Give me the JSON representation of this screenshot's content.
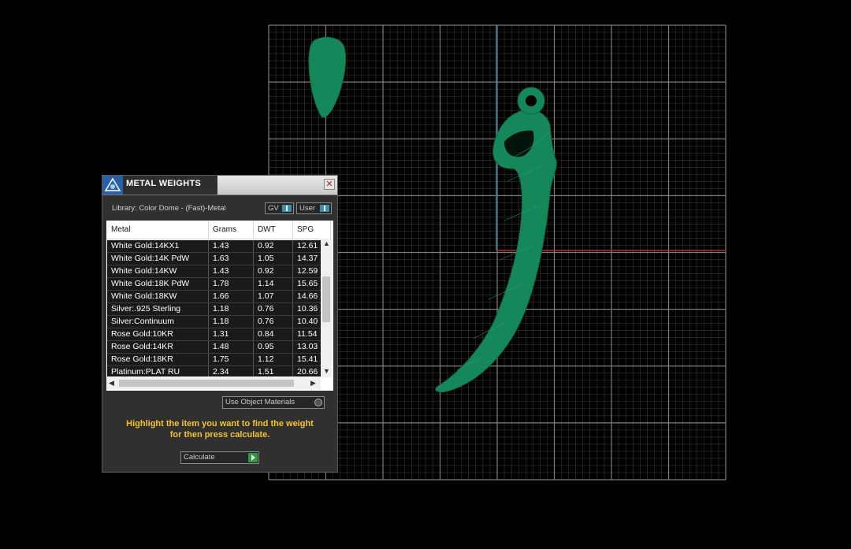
{
  "panel": {
    "title": "METAL WEIGHTS",
    "close_glyph": "✕",
    "library_label": "Library: Color Dome - (Fast)-Metal",
    "gv_toggle": "GV",
    "user_toggle": "User",
    "columns": [
      "Metal",
      "Grams",
      "DWT",
      "SPG"
    ],
    "rows": [
      [
        "White Gold:14KX1",
        "1.43",
        "0.92",
        "12.61"
      ],
      [
        "White Gold:14K PdW",
        "1.63",
        "1.05",
        "14.37"
      ],
      [
        "White Gold:14KW",
        "1.43",
        "0.92",
        "12.59"
      ],
      [
        "White Gold:18K PdW",
        "1.78",
        "1.14",
        "15.65"
      ],
      [
        "White Gold:18KW",
        "1.66",
        "1.07",
        "14.66"
      ],
      [
        "Silver:.925 Sterling",
        "1.18",
        "0.76",
        "10.36"
      ],
      [
        "Silver:Continuum",
        "1.18",
        "0.76",
        "10.40"
      ],
      [
        "Rose Gold:10KR",
        "1.31",
        "0.84",
        "11.54"
      ],
      [
        "Rose Gold:14KR",
        "1.48",
        "0.95",
        "13.03"
      ],
      [
        "Rose Gold:18KR",
        "1.75",
        "1.12",
        "15.41"
      ],
      [
        "Platinum:PLAT RU",
        "2.34",
        "1.51",
        "20.66"
      ]
    ],
    "use_object_materials": "Use Object Materials",
    "hint_line1": "Highlight the item you want to find the weight",
    "hint_line2": "for then press calculate.",
    "calculate_label": "Calculate"
  },
  "colors": {
    "model_green": "#16875a",
    "grid": "#8c8c8c",
    "x_axis": "#c0282a",
    "y_axis": "#2a7f9a",
    "hint": "#f4c430"
  }
}
